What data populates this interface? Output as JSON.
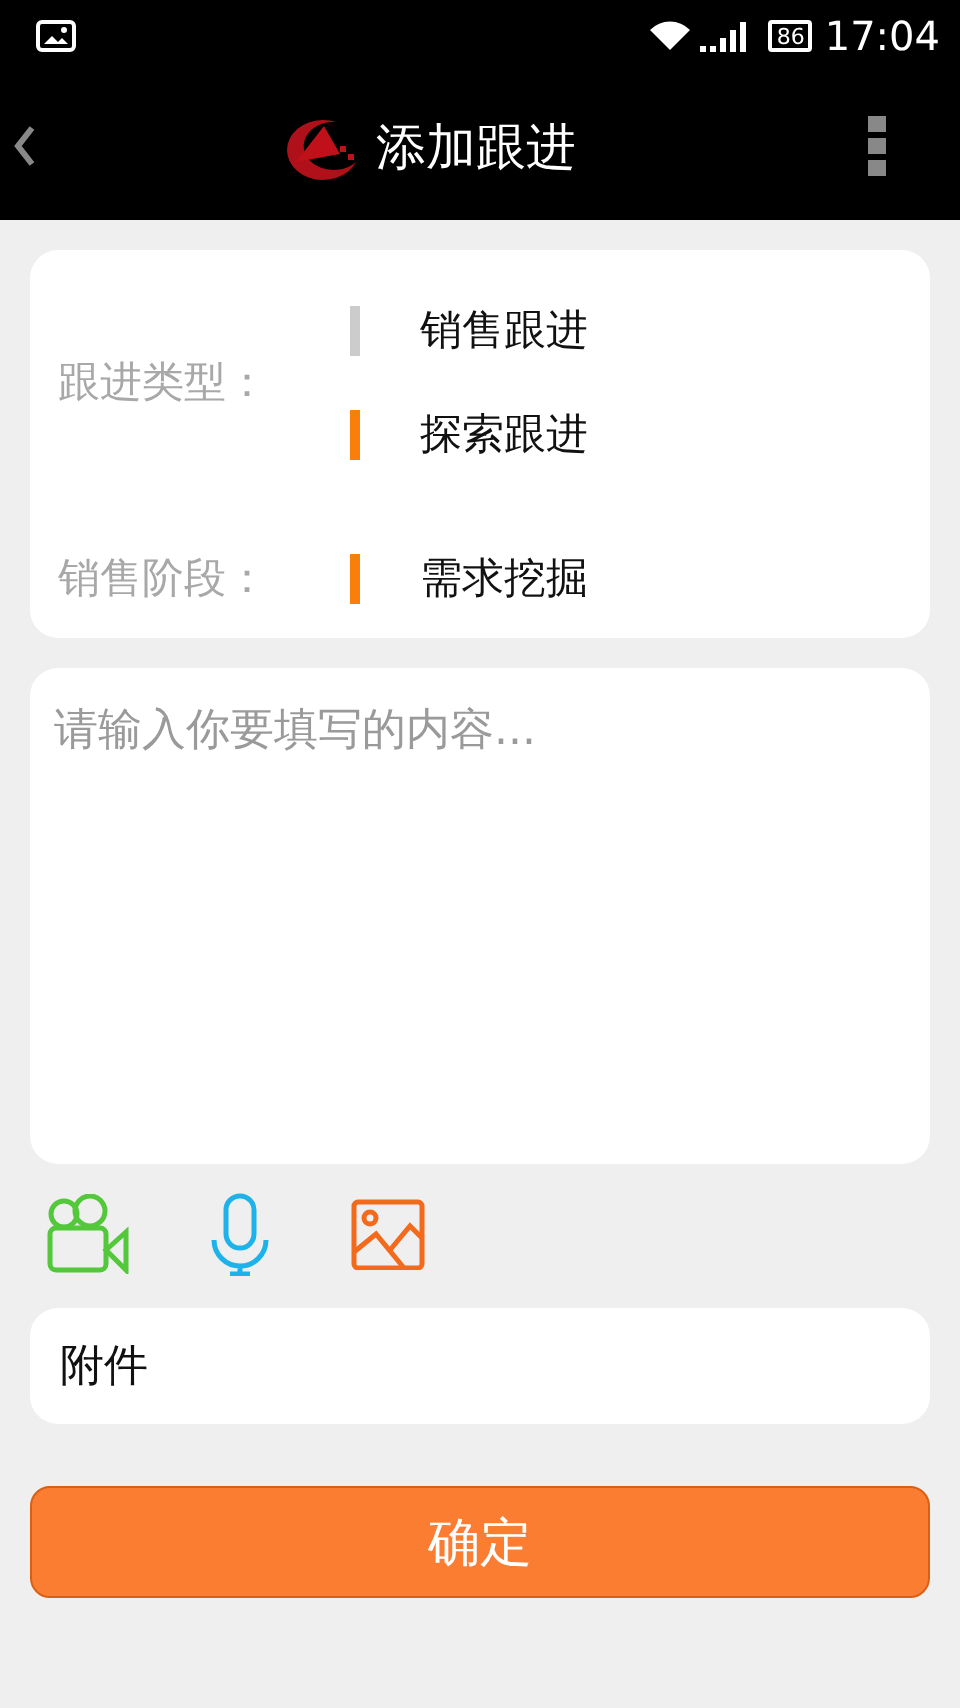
{
  "status_bar": {
    "battery": "86",
    "time": "17:04"
  },
  "app_bar": {
    "title": "添加跟进"
  },
  "form": {
    "groups": [
      {
        "label": "跟进类型：",
        "options": [
          {
            "text": "销售跟进",
            "selected": false
          },
          {
            "text": "探索跟进",
            "selected": true
          }
        ]
      },
      {
        "label": "销售阶段：",
        "options": [
          {
            "text": "需求挖掘",
            "selected": true
          }
        ]
      }
    ]
  },
  "content": {
    "placeholder": "请输入你要填写的内容..."
  },
  "attachment": {
    "label": "附件"
  },
  "confirm_button": {
    "label": "确定"
  }
}
